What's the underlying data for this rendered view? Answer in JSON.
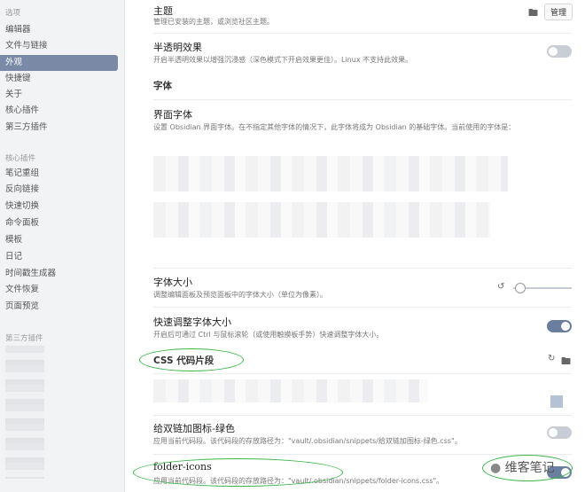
{
  "sidebar": {
    "options_header": "选项",
    "options_items": [
      "编辑器",
      "文件与链接",
      "外观",
      "快捷键",
      "关于",
      "核心插件",
      "第三方插件"
    ],
    "active_index": 2,
    "core_header": "核心插件",
    "core_items": [
      "笔记重组",
      "反向链接",
      "快速切换",
      "命令面板",
      "模板",
      "日记",
      "时间戳生成器",
      "文件恢复",
      "页面预览"
    ],
    "thirdparty_header": "第三方插件"
  },
  "main": {
    "theme_title": "主题",
    "theme_desc": "管理已安装的主题，或浏览社区主题。",
    "theme_button": "管理",
    "translucent_title": "半透明效果",
    "translucent_desc": "开启半透明效果以增强沉浸感（深色模式下开启效果更佳）。Linux 不支持此效果。",
    "translucent_on": false,
    "font_section": "字体",
    "ui_font_title": "界面字体",
    "ui_font_desc": "设置 Obsidian 界面字体。在不指定其他字体的情况下，此字体将成为 Obsidian 的基础字体。当前使用的字体是：",
    "font_size_title": "字体大小",
    "font_size_desc": "调整编辑面板及预览面板中的字体大小（单位为像素）。",
    "font_size_value": 0.1,
    "quick_font_title": "快速调整字体大小",
    "quick_font_desc": "开启后可通过 Ctrl 与鼠标滚轮（或使用触摸板手势）快速调整字体大小。",
    "quick_font_on": true,
    "css_section": "CSS 代码片段",
    "snippet1_title": "给双链加图标-绿色",
    "snippet1_desc": "应用当前代码段。该代码段的存放路径为：\"vault/.obsidian/snippets/给双链加图标-绿色.css\"。",
    "snippet1_on": false,
    "snippet2_title": "folder-icons",
    "snippet2_desc": "应用当前代码段。该代码段的存放路径为：\"vault/.obsidian/snippets/folder-icons.css\"。",
    "snippet2_on": true
  },
  "watermark": "维客笔记",
  "colors": {
    "accent": "#6a7fa0",
    "highlight": "#3bb54a",
    "active_item": "#7a8aa6"
  }
}
